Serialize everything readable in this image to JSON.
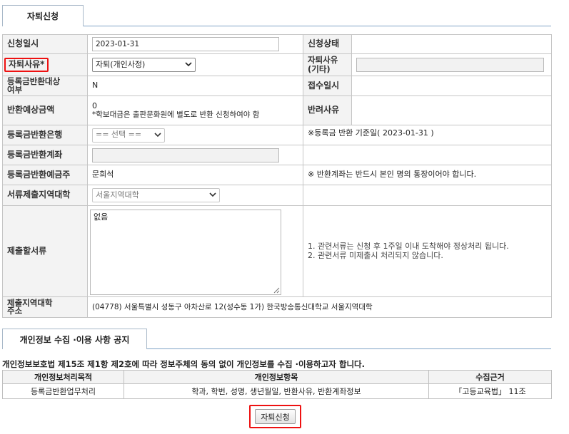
{
  "top_tab": {
    "label": "자퇴신청"
  },
  "form": {
    "apply_date_label": "신청일시",
    "apply_date_value": "2023-01-31",
    "status_label": "신청상태",
    "reason_label": "자퇴사유*",
    "reason_selected": "자퇴(개인사정)",
    "reason_etc_label": "자퇴사유\n(기타)",
    "refund_target_label": "등록금반환대상\n여부",
    "refund_target_value": "N",
    "receipt_date_label": "접수일시",
    "refund_amount_label": "반환예상금액",
    "refund_amount_value": "0",
    "refund_amount_note": "*학보대금은 출판문화원에 별도로 반환 신청하여야 함",
    "reject_reason_label": "반려사유",
    "bank_label": "등록금반환은행",
    "bank_selected": "== 선택 ==",
    "bank_note": "※등록금 반환 기준일( 2023-01-31 )",
    "account_label": "등록금반환계좌",
    "holder_label": "등록금반환예금주",
    "holder_value": "문희석",
    "holder_note": "※ 반환계좌는 반드시 본인 명의 통장이어야 합니다.",
    "region_label": "서류제출지역대학",
    "region_selected": "서울지역대학",
    "docs_label": "제출할서류",
    "docs_value": "없음",
    "docs_note_1": "1. 관련서류는 신청 후 1주일 이내 도착해야 정상처리 됩니다.",
    "docs_note_2": "2. 관련서류 미제출시 처리되지 않습니다.",
    "address_label": "제출지역대학\n주소",
    "address_value": "(04778) 서울특별시 성동구 아차산로 12(성수동 1가) 한국방송통신대학교 서울지역대학"
  },
  "privacy": {
    "tab_label": "개인정보 수집 ·이용 사항 공지",
    "notice": "개인정보보호법 제15조 제1항 제2호에 따라 정보주체의 동의 없이 개인정보를 수집 ·이용하고자 합니다.",
    "headers": [
      "개인정보처리목적",
      "개인정보항목",
      "수집근거"
    ],
    "row": [
      "등록금반환업무처리",
      "학과, 학번, 성명, 생년월일, 반환사유, 반환계좌정보",
      "「고등교육법」 11조"
    ]
  },
  "submit_label": "자퇴신청",
  "icons": {
    "dropdown": "chevron-down-icon",
    "resize": "resize-grip-icon"
  },
  "colors": {
    "highlight": "#e11111",
    "label_bg": "#f3f3f3",
    "border": "#c5c5c5"
  }
}
